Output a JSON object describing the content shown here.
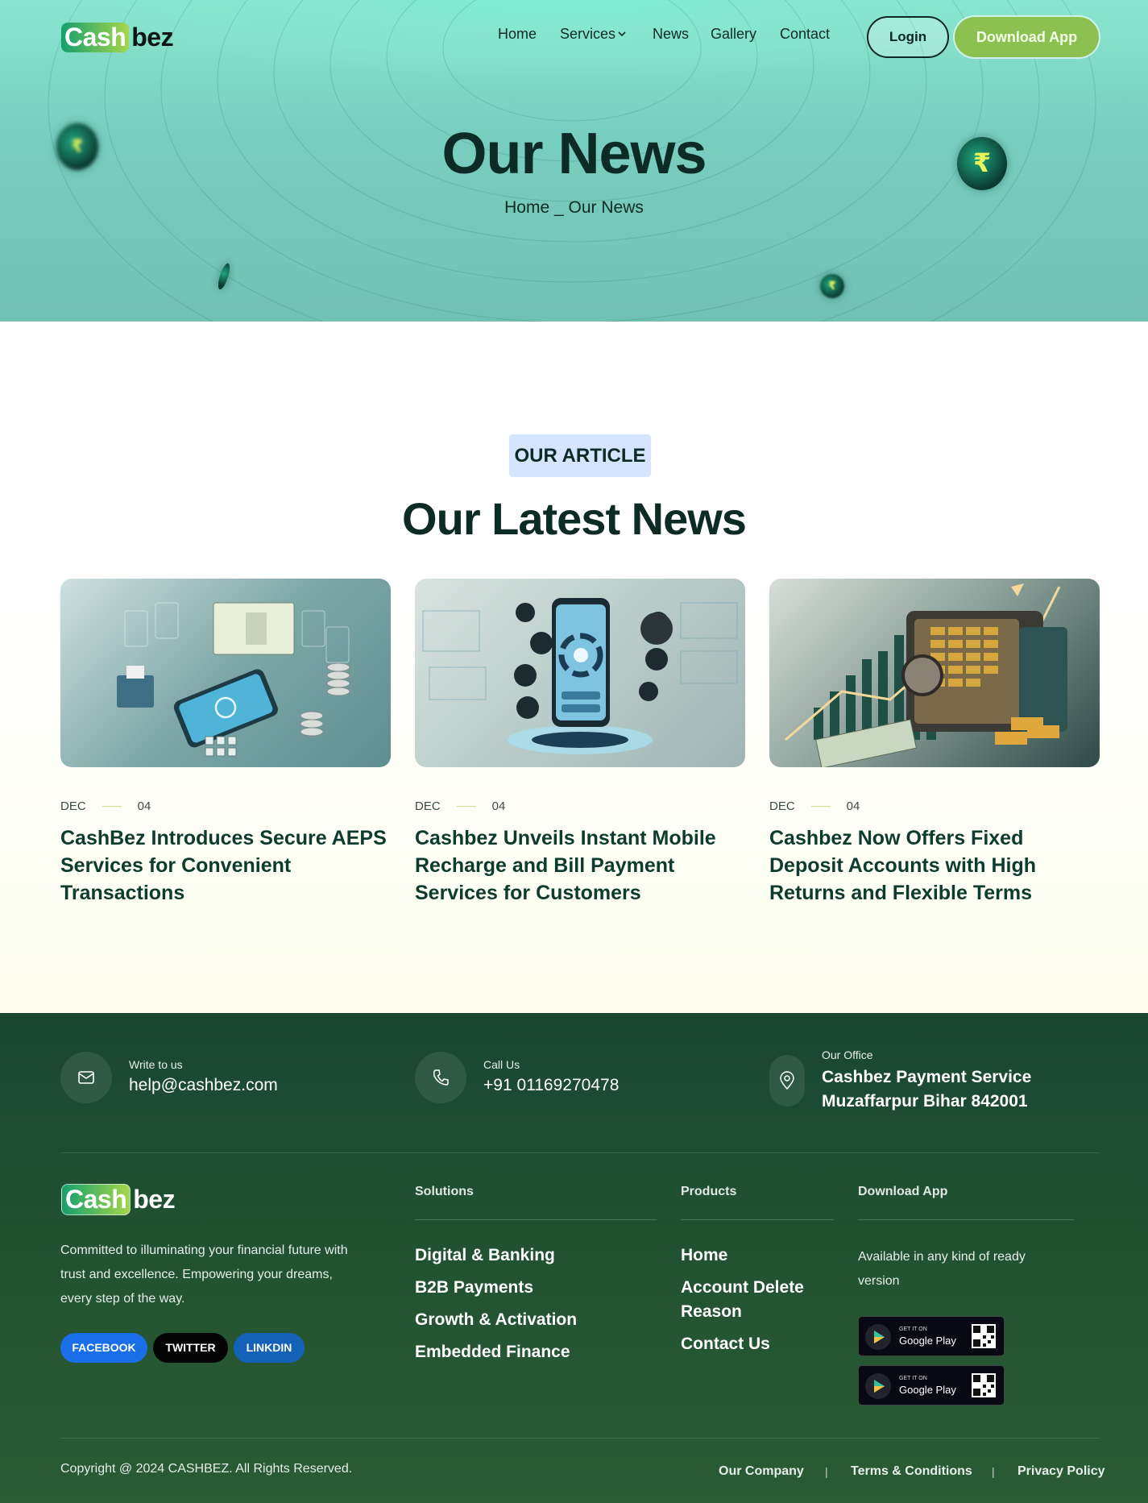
{
  "brand": {
    "logo_part1": "Cash",
    "logo_part2": "bez"
  },
  "nav": {
    "items": [
      "Home",
      "Services",
      "News",
      "Gallery",
      "Contact"
    ],
    "login": "Login",
    "download": "Download App"
  },
  "hero": {
    "title": "Our News",
    "breadcrumb_home": "Home",
    "breadcrumb_sep": "_",
    "breadcrumb_current": "Our News",
    "coin_symbol": "₹"
  },
  "news": {
    "tag": "OUR ARTICLE",
    "title": "Our Latest News",
    "articles": [
      {
        "month": "DEC",
        "day": "04",
        "title": "CashBez Introduces Secure AEPS Services for Convenient Transactions"
      },
      {
        "month": "DEC",
        "day": "04",
        "title": "Cashbez Unveils Instant Mobile Recharge and Bill Payment Services for Customers"
      },
      {
        "month": "DEC",
        "day": "04",
        "title": "Cashbez Now Offers Fixed Deposit Accounts with High Returns and Flexible Terms"
      }
    ]
  },
  "footer": {
    "contact": {
      "email_label": "Write to us",
      "email": "help@cashbez.com",
      "phone_label": "Call Us",
      "phone": "+91 01169270478",
      "office_label": "Our Office",
      "office_line1": "Cashbez Payment Service",
      "office_line2": "Muzaffarpur Bihar 842001"
    },
    "about": "Committed to illuminating your financial future with trust and excellence. Empowering your dreams, every step of the way.",
    "social": [
      "FACEBOOK",
      "TWITTER",
      "LINKDIN"
    ],
    "solutions": {
      "heading": "Solutions",
      "links": [
        "Digital & Banking",
        "B2B Payments",
        "Growth & Activation",
        "Embedded Finance"
      ]
    },
    "products": {
      "heading": "Products",
      "links": [
        "Home",
        "Account Delete Reason",
        "Contact Us"
      ]
    },
    "download": {
      "heading": "Download App",
      "text": "Available in any kind of ready version",
      "badge_small": "GET IT ON",
      "badge_big": "Google Play"
    },
    "copyright": "Copyright @ 2024 CASHBEZ. All Rights Reserved.",
    "legal": [
      "Our Company",
      "Terms & Conditions",
      "Privacy Policy"
    ],
    "legal_sep": "|"
  },
  "colors": {
    "accent": "#8cc152",
    "footer_bg": "#245431",
    "title": "#0d2b25",
    "tag_bg": "#d6e5ff"
  }
}
